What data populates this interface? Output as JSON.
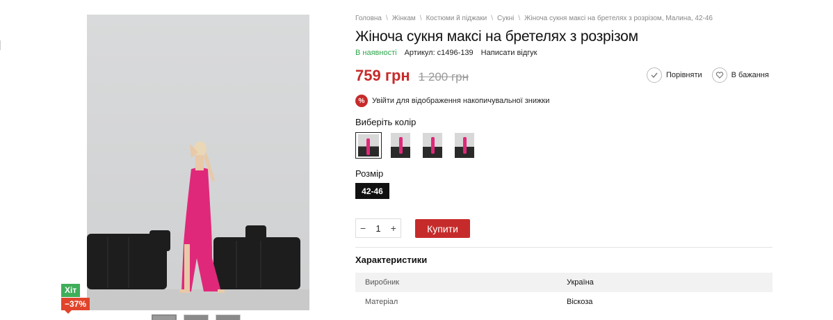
{
  "breadcrumb": [
    "Головна",
    "Жінкам",
    "Костюми й піджаки",
    "Сукні",
    "Жіноча сукня максі на бретелях з розрізом, Малина, 42-46"
  ],
  "product": {
    "title": "Жіноча сукня максі на бретелях з розрізом",
    "stock": "В наявності",
    "sku": "Артикул: c1496-139",
    "review": "Написати відгук",
    "price_now": "759 грн",
    "price_old": "1 200 грн"
  },
  "actions": {
    "compare": "Порівняти",
    "wishlist": "В бажання"
  },
  "promo": {
    "icon": "%",
    "text": "Увійти для відображення накопичувальної знижки"
  },
  "color": {
    "label": "Виберіть колір",
    "swatches": 4,
    "selected": 0
  },
  "size": {
    "label": "Розмір",
    "value": "42-46"
  },
  "cart": {
    "minus": "−",
    "qty": "1",
    "plus": "+",
    "buy": "Купити"
  },
  "badges": {
    "hit": "Хіт",
    "sale": "−37%"
  },
  "characteristics": {
    "title": "Характеристики",
    "rows": [
      {
        "key": "Виробник",
        "value": "Україна"
      },
      {
        "key": "Матеріал",
        "value": "Віскоза"
      }
    ]
  },
  "colors": {
    "price": "#c62b2b",
    "stock": "#2fa64e",
    "dress": "#e0287a"
  }
}
